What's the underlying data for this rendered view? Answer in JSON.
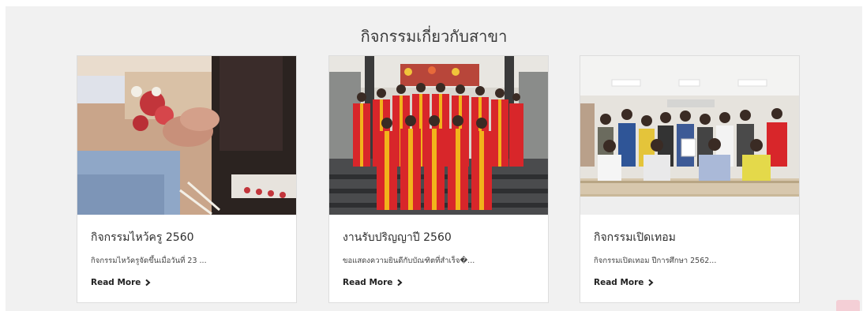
{
  "section": {
    "title": "กิจกรรมเกี่ยวกับสาขา"
  },
  "cards": [
    {
      "title": "กิจกรรมไหว้ครู 2560",
      "excerpt": "กิจกรรมไหว้ครูจัดขึ้นเมื่อวันที่ 23 ...",
      "read_more": "Read More",
      "image_icon": "wai-khru-ceremony-photo"
    },
    {
      "title": "งานรับปริญญาปี 2560",
      "excerpt": "ขอแสดงความยินดีกับบัณฑิตที่สำเร็จ�...",
      "read_more": "Read More",
      "image_icon": "graduation-group-photo"
    },
    {
      "title": "กิจกรรมเปิดเทอม",
      "excerpt": "กิจกรรมเปิดเทอม ปีการศึกษา 2562...",
      "read_more": "Read More",
      "image_icon": "orientation-group-photo"
    }
  ],
  "colors": {
    "section_bg": "#f1f1f1",
    "card_bg": "#ffffff",
    "gown_red": "#d8262a",
    "gown_gold": "#f2b31b",
    "scroll_btn": "#f4cfd6"
  }
}
